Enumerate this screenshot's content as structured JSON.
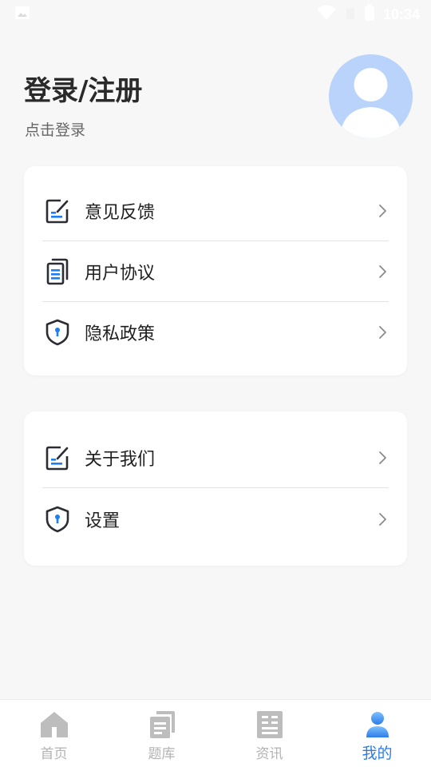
{
  "status": {
    "time": "10:34"
  },
  "header": {
    "title": "登录/注册",
    "subtitle": "点击登录"
  },
  "menu_group_1": [
    {
      "label": "意见反馈",
      "icon": "feedback-icon"
    },
    {
      "label": "用户协议",
      "icon": "document-icon"
    },
    {
      "label": "隐私政策",
      "icon": "shield-icon"
    }
  ],
  "menu_group_2": [
    {
      "label": "关于我们",
      "icon": "feedback-icon"
    },
    {
      "label": "设置",
      "icon": "shield-icon"
    }
  ],
  "tabs": [
    {
      "label": "首页",
      "icon": "home-icon"
    },
    {
      "label": "题库",
      "icon": "question-bank-icon"
    },
    {
      "label": "资讯",
      "icon": "news-icon"
    },
    {
      "label": "我的",
      "icon": "profile-icon",
      "active": true
    }
  ],
  "colors": {
    "accent": "#2e7ce8",
    "icon_dark": "#2c2c34",
    "icon_blue": "#1e7ef0",
    "avatar_bg": "#b9d3fb"
  }
}
